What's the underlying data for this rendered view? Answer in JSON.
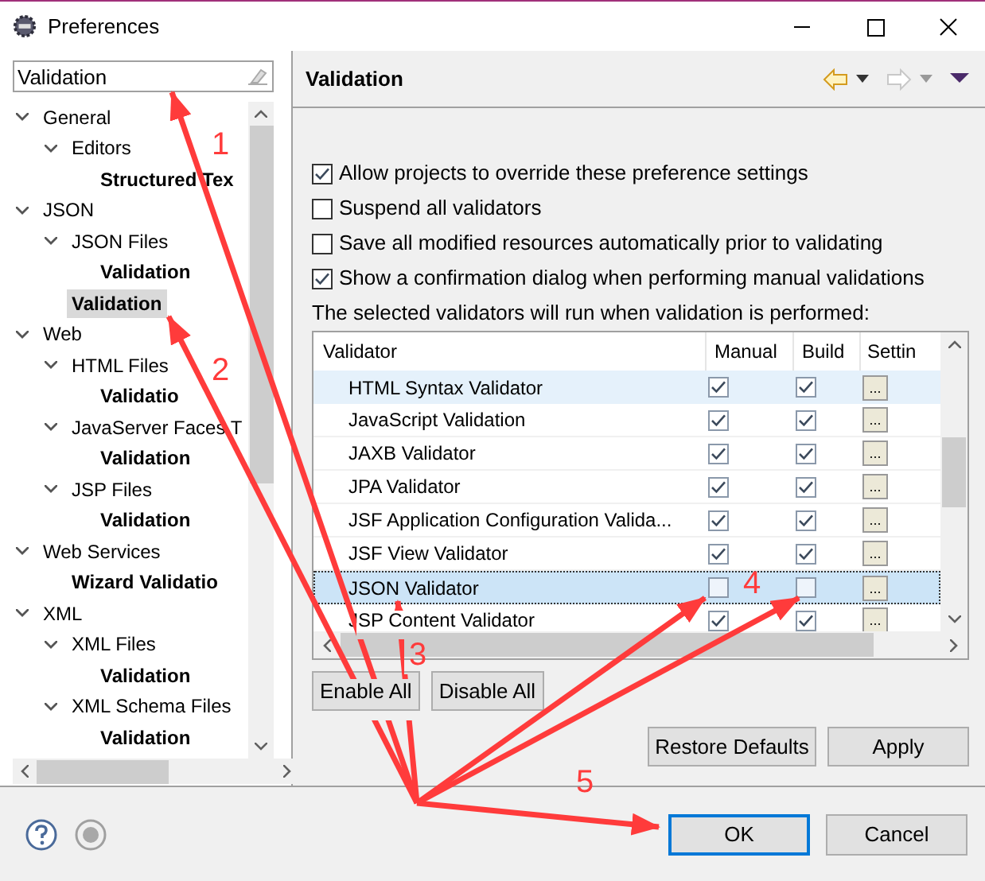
{
  "window": {
    "title": "Preferences"
  },
  "filter": {
    "value": "Validation"
  },
  "tree": [
    {
      "label": "General",
      "expanded": true,
      "selected": false,
      "children": [
        {
          "label": "Editors",
          "expanded": true,
          "selected": false,
          "children": [
            {
              "label": "Structured Tex",
              "selected": false
            }
          ]
        }
      ]
    },
    {
      "label": "JSON",
      "expanded": true,
      "selected": false,
      "children": [
        {
          "label": "JSON Files",
          "expanded": true,
          "selected": false,
          "children": [
            {
              "label": "Validation",
              "selected": false
            }
          ]
        },
        {
          "label": "Validation",
          "selected": true
        }
      ]
    },
    {
      "label": "Web",
      "expanded": true,
      "selected": false,
      "children": [
        {
          "label": "HTML Files",
          "expanded": true,
          "selected": false,
          "children": [
            {
              "label": "Validatio",
              "selected": false
            }
          ]
        },
        {
          "label": "JavaServer Faces T",
          "expanded": true,
          "selected": false,
          "children": [
            {
              "label": "Validation",
              "selected": false
            }
          ]
        },
        {
          "label": "JSP Files",
          "expanded": true,
          "selected": false,
          "children": [
            {
              "label": "Validation",
              "selected": false
            }
          ]
        }
      ]
    },
    {
      "label": "Web Services",
      "expanded": true,
      "selected": false,
      "children": [
        {
          "label": "Wizard Validatio",
          "selected": false
        }
      ]
    },
    {
      "label": "XML",
      "expanded": true,
      "selected": false,
      "children": [
        {
          "label": "XML Files",
          "expanded": true,
          "selected": false,
          "children": [
            {
              "label": "Validation",
              "selected": false
            }
          ]
        },
        {
          "label": "XML Schema Files",
          "expanded": true,
          "selected": false,
          "children": [
            {
              "label": "Validation",
              "selected": false
            }
          ]
        }
      ]
    }
  ],
  "page": {
    "title": "Validation",
    "options": [
      {
        "label": "Allow projects to override these preference settings",
        "checked": true
      },
      {
        "label": "Suspend all validators",
        "checked": false
      },
      {
        "label": "Save all modified resources automatically prior to validating",
        "checked": false
      },
      {
        "label": "Show a confirmation dialog when performing manual validations",
        "checked": true
      }
    ],
    "note": "The selected validators will run when validation is performed:",
    "table": {
      "columns": [
        "Validator",
        "Manual",
        "Build",
        "Settin"
      ],
      "rows": [
        {
          "name": "HTML Syntax Validator",
          "manual": true,
          "build": true,
          "settings": "...",
          "selected": false,
          "hovered": true
        },
        {
          "name": "JavaScript Validation",
          "manual": true,
          "build": true,
          "settings": "...",
          "selected": false
        },
        {
          "name": "JAXB Validator",
          "manual": true,
          "build": true,
          "settings": "...",
          "selected": false
        },
        {
          "name": "JPA Validator",
          "manual": true,
          "build": true,
          "settings": "...",
          "selected": false
        },
        {
          "name": "JSF Application Configuration Valida...",
          "manual": true,
          "build": true,
          "settings": "...",
          "selected": false
        },
        {
          "name": "JSF View Validator",
          "manual": true,
          "build": true,
          "settings": "...",
          "selected": false
        },
        {
          "name": "JSON Validator",
          "manual": false,
          "build": false,
          "settings": "...",
          "selected": true
        },
        {
          "name": "JSP Content Validator",
          "manual": true,
          "build": true,
          "settings": "...",
          "selected": false
        }
      ]
    },
    "table_buttons": [
      "Enable All",
      "Disable All"
    ],
    "buttons": [
      "Restore Defaults",
      "Apply"
    ]
  },
  "dialog_buttons": [
    {
      "label": "OK",
      "default": true
    },
    {
      "label": "Cancel",
      "default": false
    }
  ],
  "annotations": [
    "1",
    "2",
    "3",
    "4",
    "5"
  ]
}
